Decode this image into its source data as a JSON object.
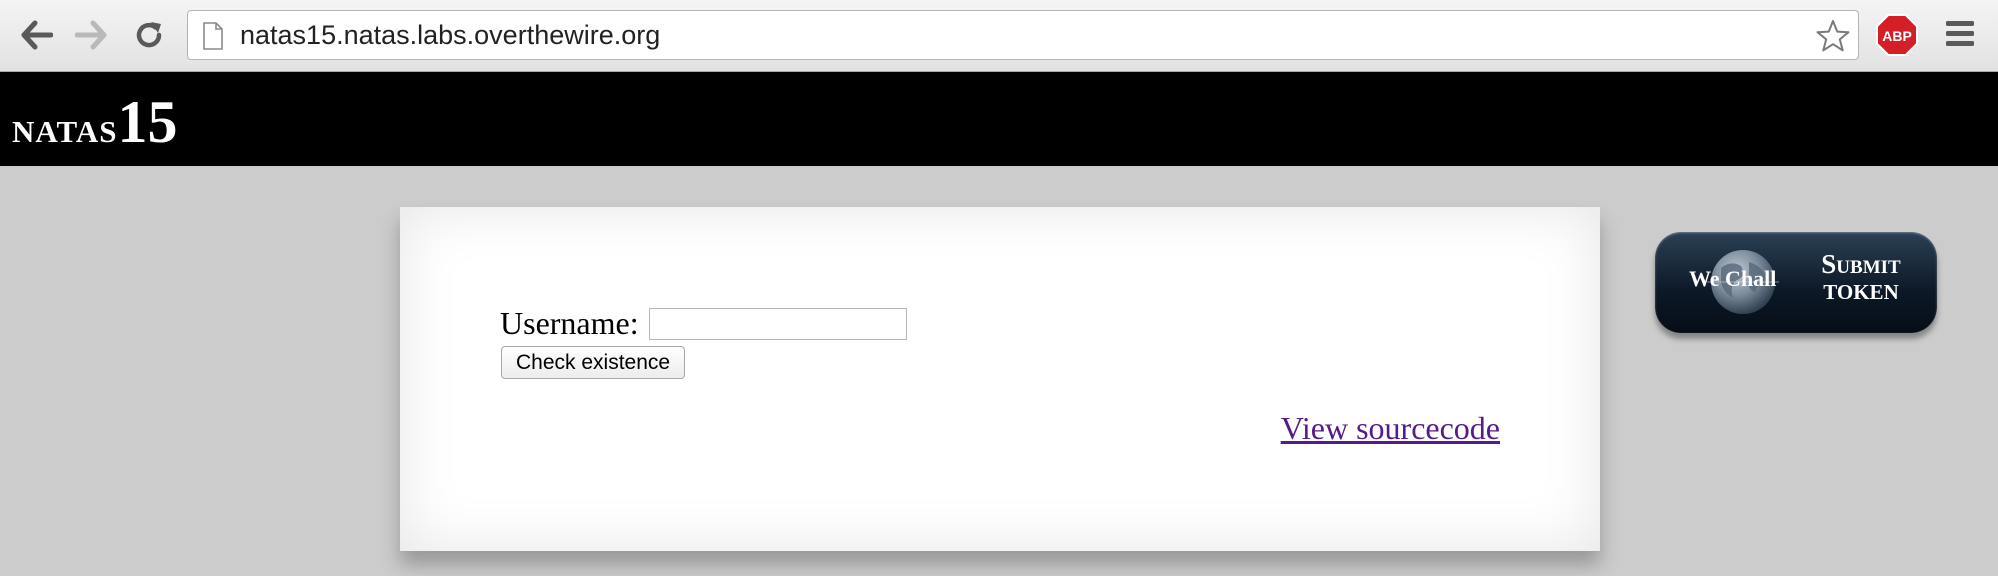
{
  "browser": {
    "url": "natas15.natas.labs.overthewire.org",
    "back_icon": "back-arrow-icon",
    "forward_icon": "forward-arrow-icon",
    "reload_icon": "reload-icon",
    "bookmark_icon": "star-icon",
    "extension_label": "ABP",
    "menu_icon": "hamburger-menu-icon"
  },
  "header": {
    "title_prefix": "natas",
    "title_number": "15"
  },
  "form": {
    "username_label": "Username:",
    "username_value": "",
    "check_button_label": "Check existence"
  },
  "links": {
    "view_source": "View sourcecode"
  },
  "wechall": {
    "logo_text": "We Chall",
    "submit_line1": "Submit",
    "submit_line2": "token"
  },
  "colors": {
    "page_background": "#cccccc",
    "header_background": "#000000",
    "link_visited": "#551a8b",
    "abp_red": "#d41f26"
  }
}
